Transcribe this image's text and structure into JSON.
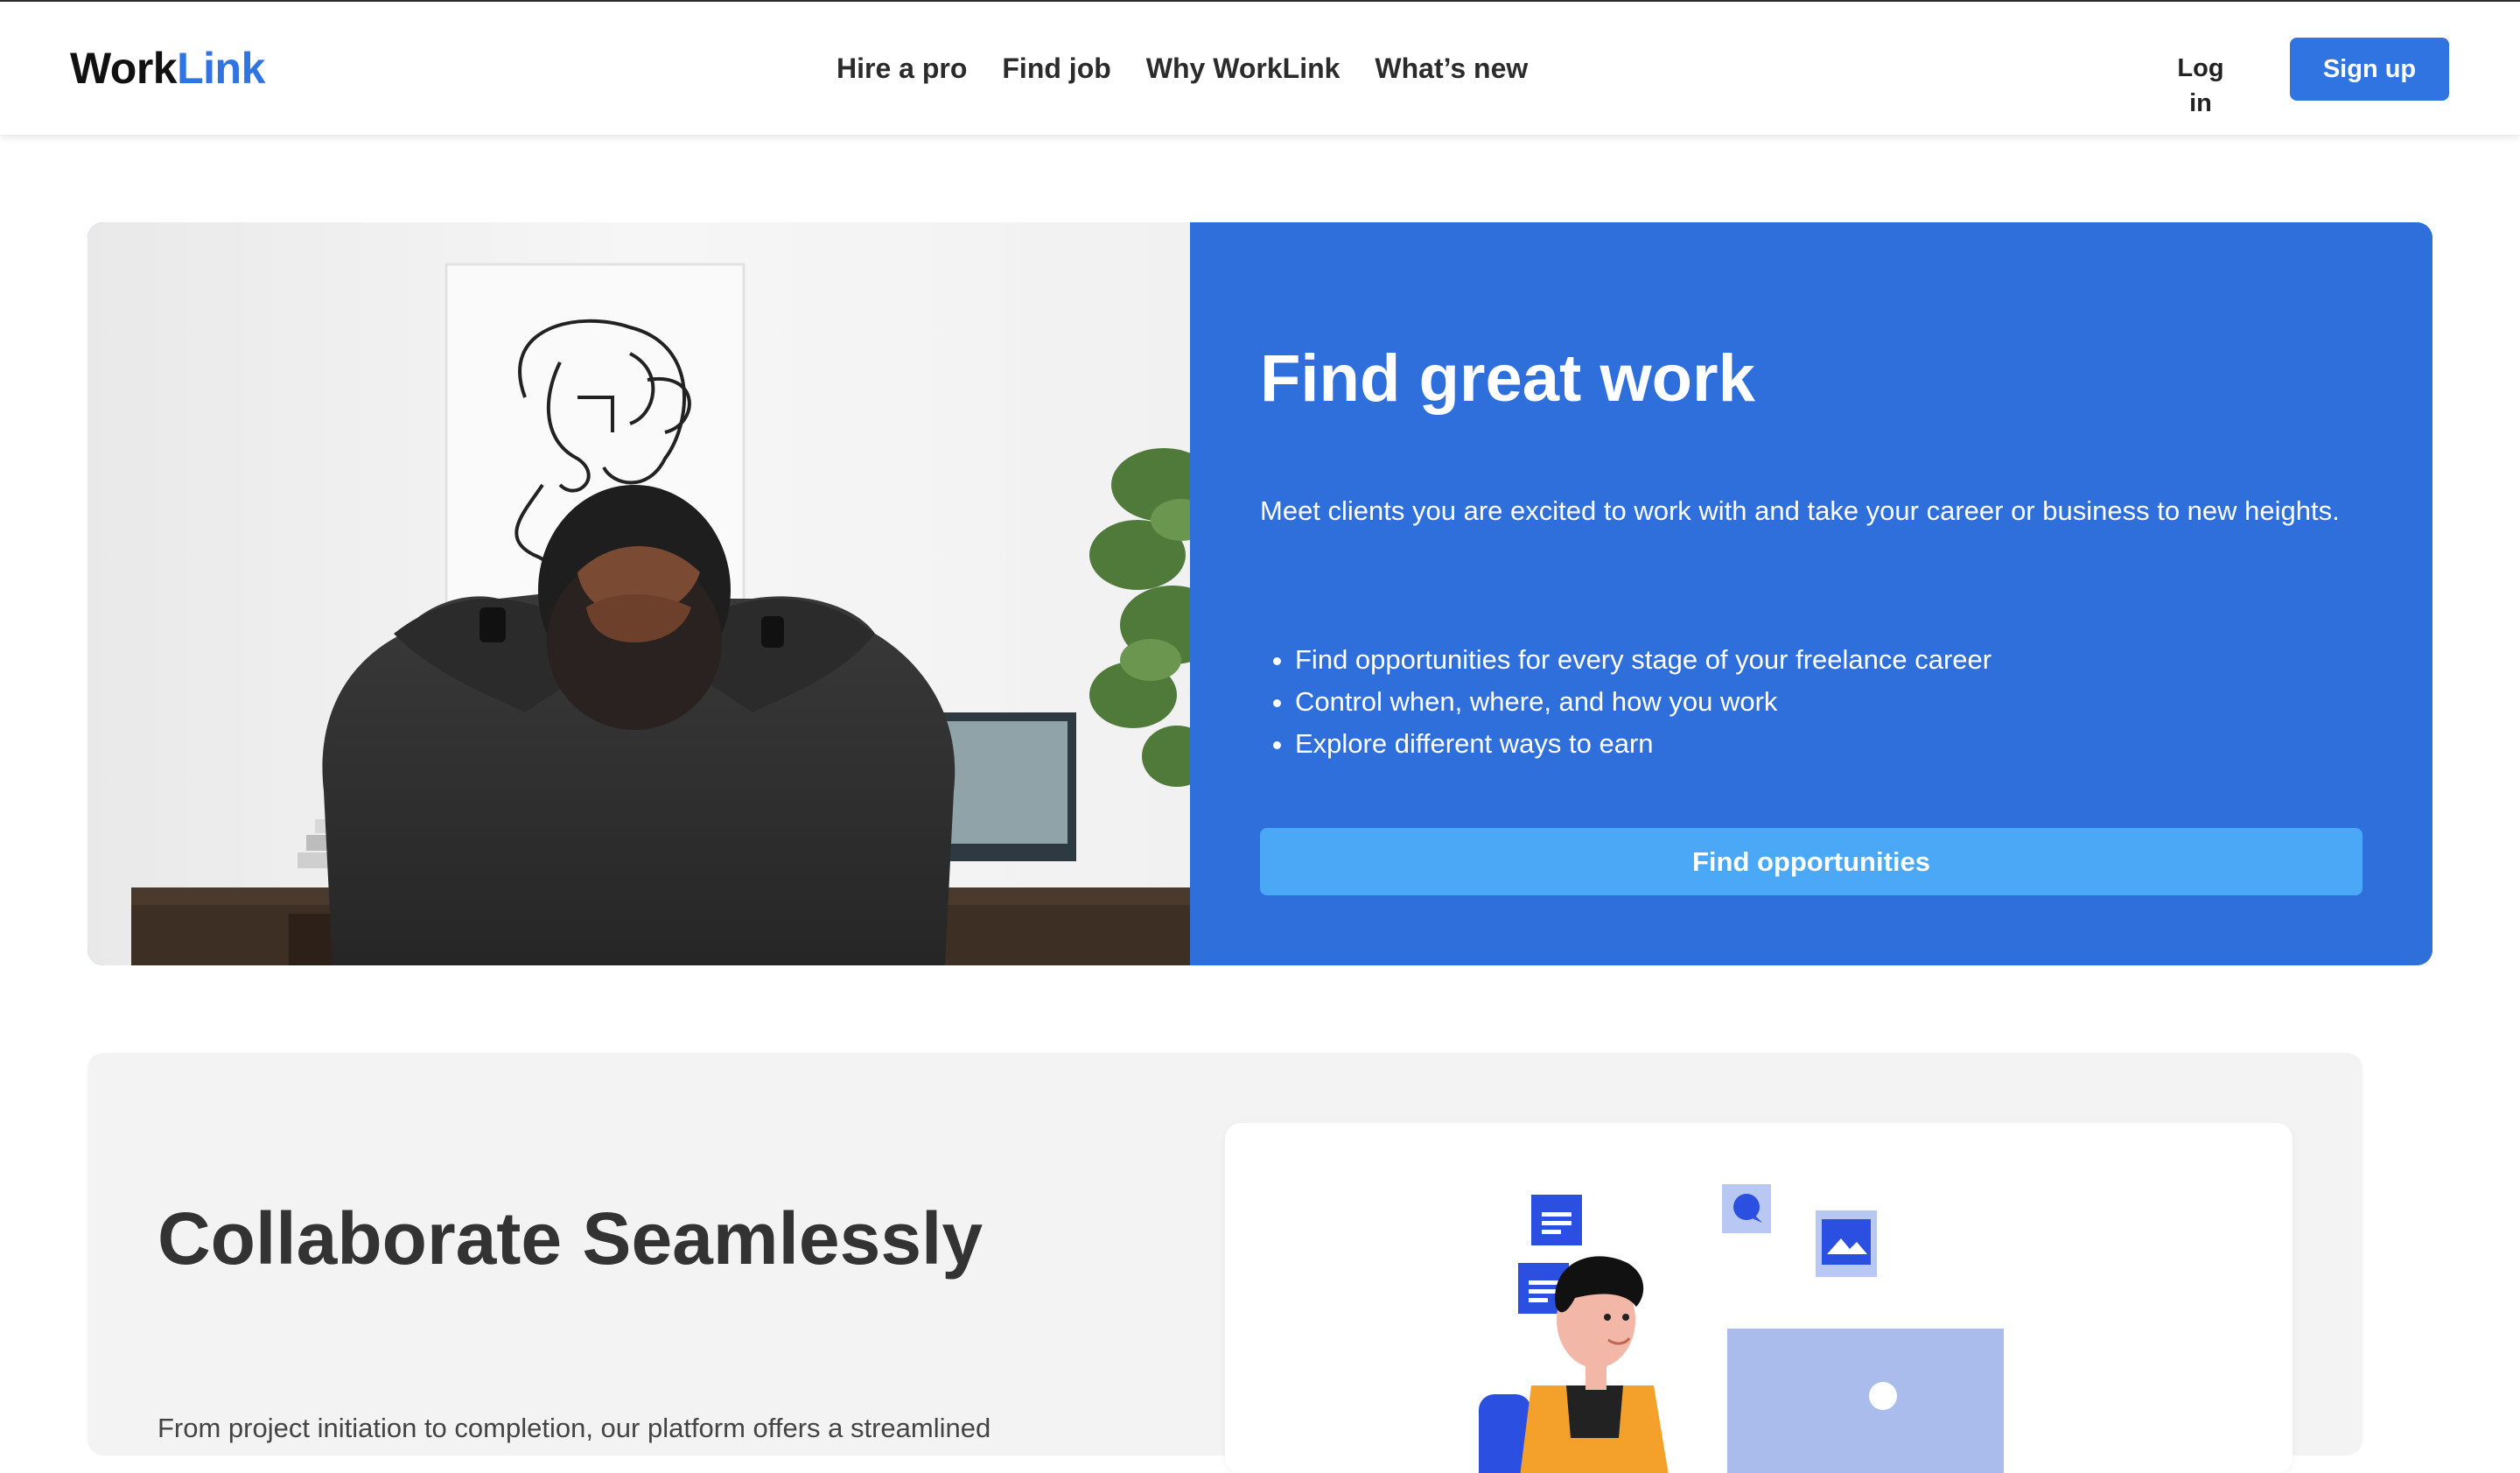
{
  "brand": {
    "part1": "Work",
    "part2": "Link",
    "accent_color": "#2f74e0"
  },
  "nav": {
    "links": [
      "Hire a pro",
      "Find job",
      "Why WorkLink",
      "What’s new"
    ],
    "login": "Log in",
    "signup": "Sign up"
  },
  "hero": {
    "title": "Find great work",
    "description": "Meet clients you are excited to work with and take your career or business to new heights.",
    "bullets": [
      "Find opportunities for every stage of your freelance career",
      "Control when, where, and how you work",
      "Explore different ways to earn"
    ],
    "cta": "Find opportunities",
    "panel_color": "#2f6fdc",
    "cta_color": "#4aa8f6"
  },
  "collab": {
    "title": "Collaborate Seamlessly",
    "text": "From project initiation to completion, our platform offers a streamlined"
  }
}
